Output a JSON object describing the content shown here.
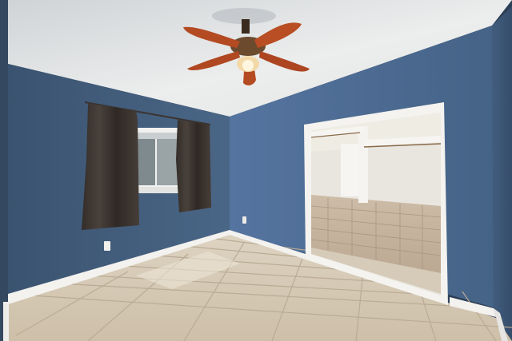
{
  "scene": {
    "kind": "photo",
    "subject": "empty-bedroom",
    "colors": {
      "ceiling": "#e9eaea",
      "wall_left": "#44607f",
      "wall_back": "#4f6d92",
      "wall_right": "#3d5776",
      "baseboard": "#f2f2f0",
      "floor_tile": "#d7ccb8",
      "grout": "#bcae97",
      "curtain": "#3e3732",
      "fan_blade": "#b44a22",
      "closet_wall": "#ecebe6",
      "closet_tile": "#c8b59f"
    },
    "icons": [
      "ceiling-fan-icon",
      "window-icon",
      "closet-icon",
      "outlet-icon"
    ]
  }
}
